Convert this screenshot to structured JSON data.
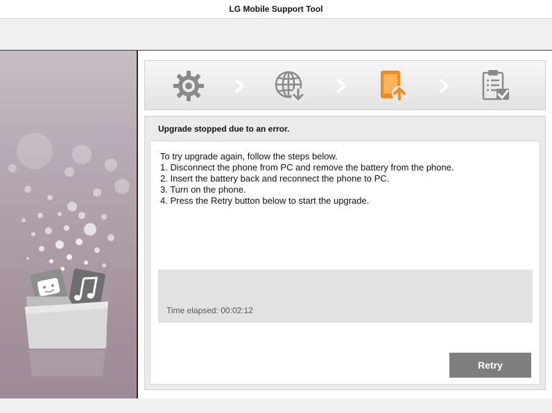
{
  "window": {
    "title": "LG Mobile Support Tool"
  },
  "steps": [
    {
      "name": "settings-gear-icon",
      "state": "done"
    },
    {
      "name": "globe-download-icon",
      "state": "done"
    },
    {
      "name": "phone-upload-icon",
      "state": "active"
    },
    {
      "name": "clipboard-check-icon",
      "state": "pending"
    }
  ],
  "colors": {
    "active_step": "#f28a1e",
    "inactive_step": "#8a8a8a",
    "retry_button": "#7f7f7f"
  },
  "status": {
    "heading": "Upgrade stopped due to an error.",
    "instructions": [
      "To try upgrade again, follow the steps below.",
      "1. Disconnect the phone from PC and remove the battery from the phone.",
      "2. Insert the battery back and reconnect the phone to PC.",
      "3. Turn on the phone.",
      "4. Press the Retry button below to start the upgrade."
    ],
    "time_elapsed": "Time elapsed: 00:02:12"
  },
  "buttons": {
    "retry_label": "Retry"
  }
}
